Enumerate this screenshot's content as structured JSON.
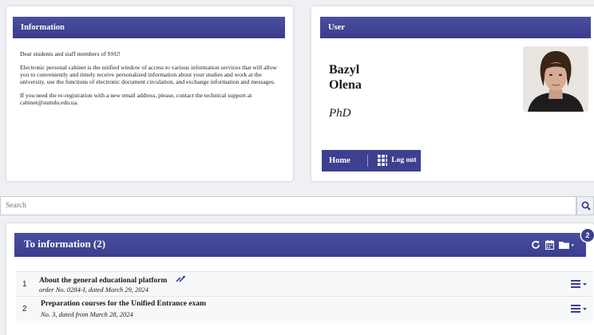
{
  "info": {
    "title": "Information",
    "paragraphs": [
      "Dear students and staff members of SSU!",
      "Electronic personal cabinet is the unified window of access to various information services that will allow you to conveniently and timely receive personalized information about your studies and work at the university, use the functions of electronic document circulation, and exchange information and messages.",
      "If you need the re-registration with a new email address, please, contact the technical support at cabinet@sumdu.edu.ua."
    ]
  },
  "user": {
    "title": "User",
    "last_name": "Bazyl",
    "first_name": "Olena",
    "degree": "PhD",
    "home_label": "Home",
    "logout_label": "Log out"
  },
  "search": {
    "placeholder": "Search"
  },
  "documents": {
    "title": "To information (2)",
    "badge": "2",
    "items": [
      {
        "num": "1",
        "title": "About the general educational platform",
        "subtitle": "order No. 0284-I, dated March 29, 2024"
      },
      {
        "num": "2",
        "title": "Preparation courses for the Unified Entrance exam",
        "subtitle": "No. 3, dated from March 28, 2024"
      }
    ]
  },
  "colors": {
    "accent": "#3d4090",
    "header_gradient_top": "#4b4fa0"
  }
}
